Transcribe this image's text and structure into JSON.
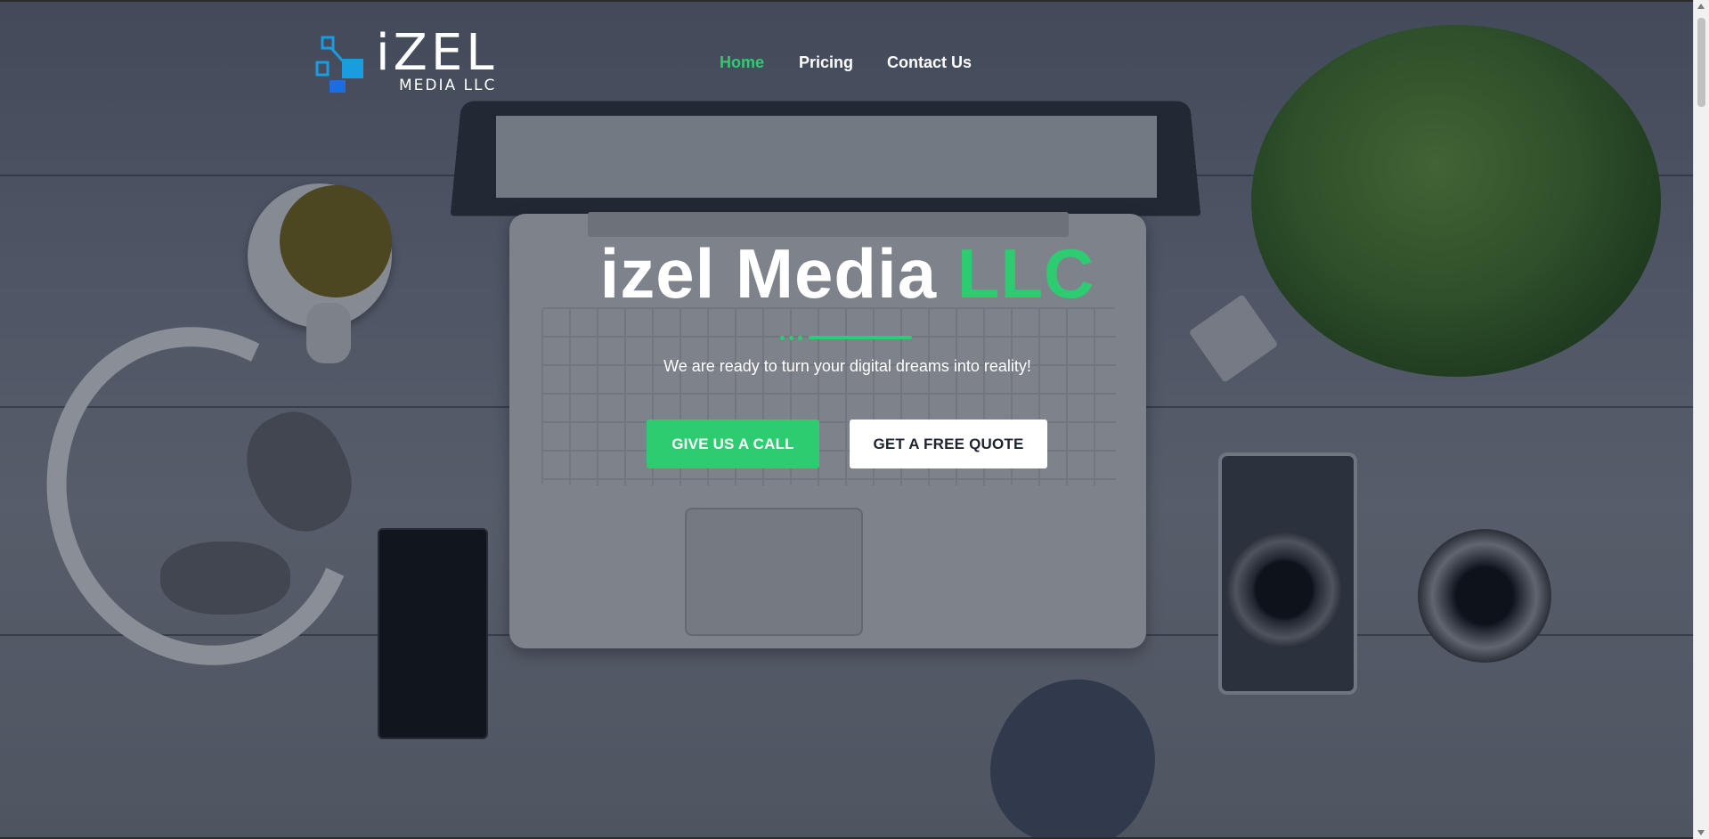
{
  "brand": {
    "logo_word": "iZEL",
    "logo_sub": "MEDIA LLC",
    "colors": {
      "accent": "#2ecc71",
      "logo_blue": "#1a9ce0"
    }
  },
  "nav": {
    "items": [
      {
        "label": "Home",
        "active": true
      },
      {
        "label": "Pricing",
        "active": false
      },
      {
        "label": "Contact Us",
        "active": false
      }
    ]
  },
  "hero": {
    "title_main": "izel Media ",
    "title_accent": "LLC",
    "subtitle": "We are ready to turn your digital dreams into reality!",
    "primary_button": "GIVE US A CALL",
    "secondary_button": "GET A FREE QUOTE"
  },
  "background": {
    "icon": "desk-photo-icon"
  }
}
